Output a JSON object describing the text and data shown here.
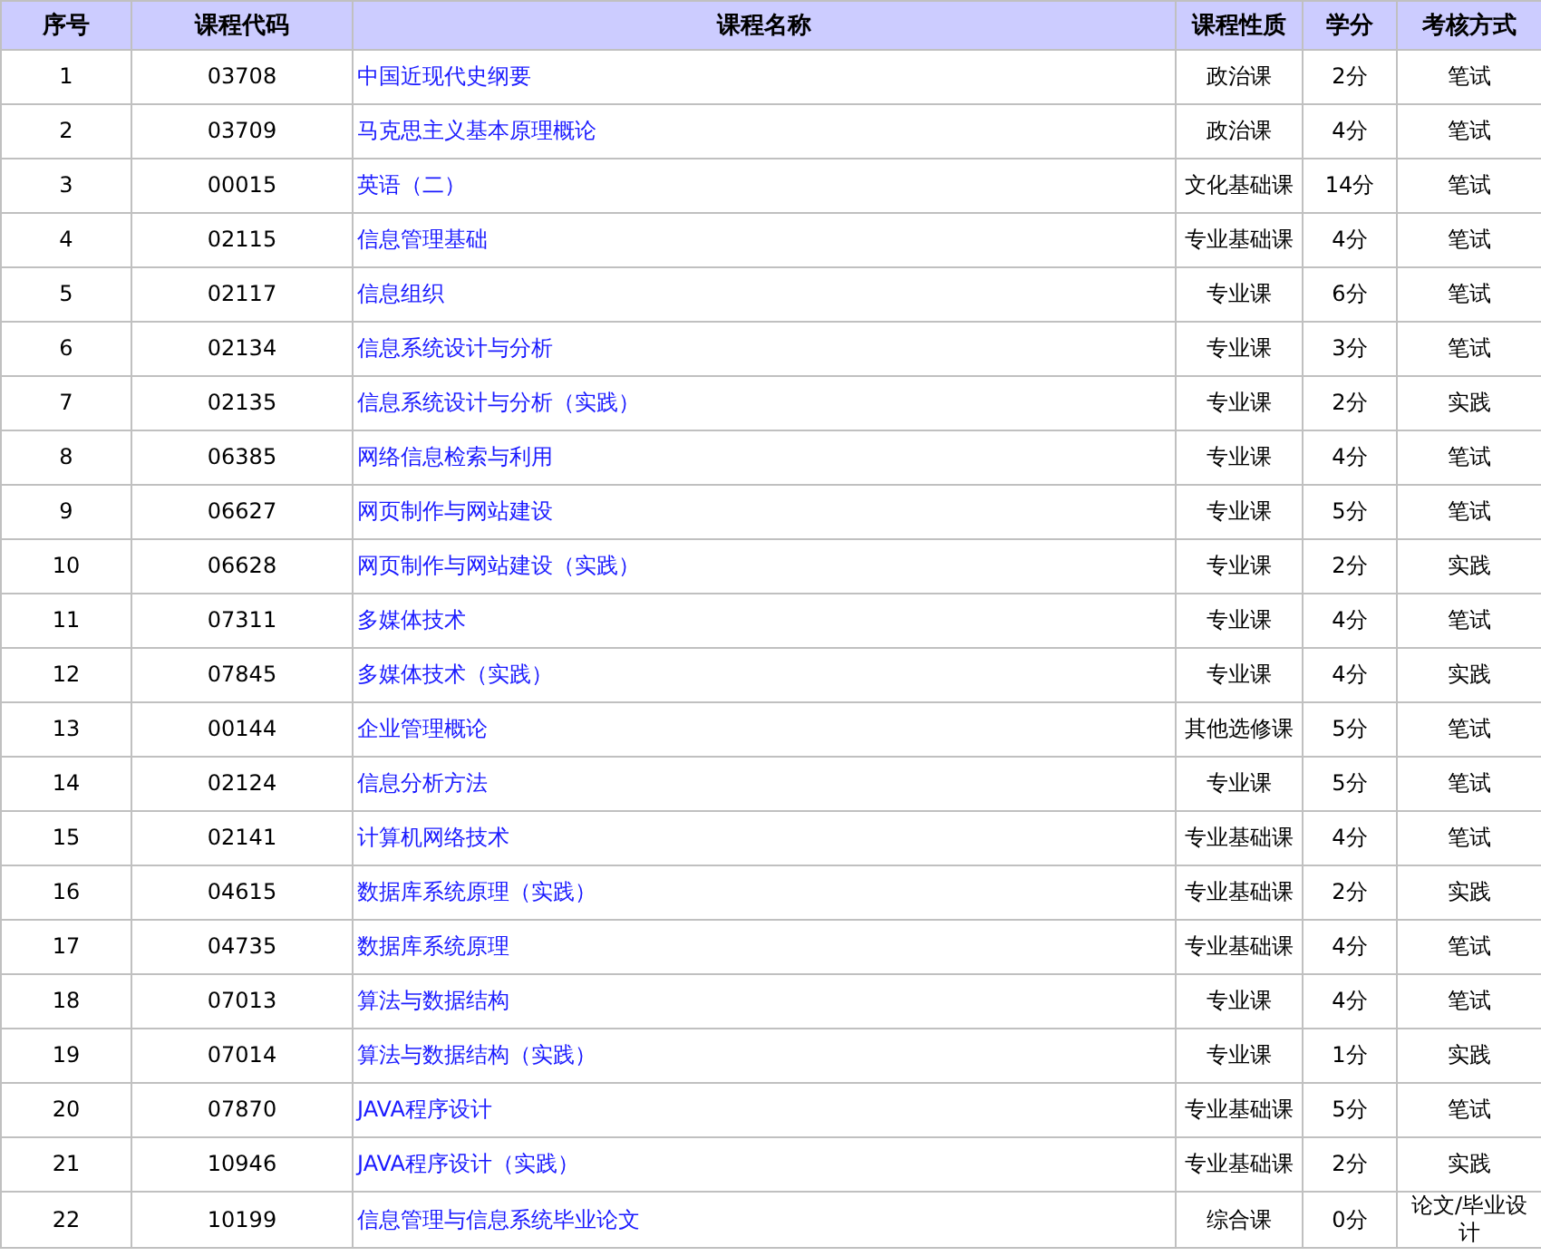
{
  "table": {
    "columns": [
      "序号",
      "课程代码",
      "课程名称",
      "课程性质",
      "学分",
      "考核方式"
    ],
    "rows": [
      [
        "1",
        "03708",
        "中国近现代史纲要",
        "政治课",
        "2分",
        "笔试"
      ],
      [
        "2",
        "03709",
        "马克思主义基本原理概论",
        "政治课",
        "4分",
        "笔试"
      ],
      [
        "3",
        "00015",
        "英语（二）",
        "文化基础课",
        "14分",
        "笔试"
      ],
      [
        "4",
        "02115",
        "信息管理基础",
        "专业基础课",
        "4分",
        "笔试"
      ],
      [
        "5",
        "02117",
        "信息组织",
        "专业课",
        "6分",
        "笔试"
      ],
      [
        "6",
        "02134",
        "信息系统设计与分析",
        "专业课",
        "3分",
        "笔试"
      ],
      [
        "7",
        "02135",
        "信息系统设计与分析（实践）",
        "专业课",
        "2分",
        "实践"
      ],
      [
        "8",
        "06385",
        "网络信息检索与利用",
        "专业课",
        "4分",
        "笔试"
      ],
      [
        "9",
        "06627",
        "网页制作与网站建设",
        "专业课",
        "5分",
        "笔试"
      ],
      [
        "10",
        "06628",
        "网页制作与网站建设（实践）",
        "专业课",
        "2分",
        "实践"
      ],
      [
        "11",
        "07311",
        "多媒体技术",
        "专业课",
        "4分",
        "笔试"
      ],
      [
        "12",
        "07845",
        "多媒体技术（实践）",
        "专业课",
        "4分",
        "实践"
      ],
      [
        "13",
        "00144",
        "企业管理概论",
        "其他选修课",
        "5分",
        "笔试"
      ],
      [
        "14",
        "02124",
        "信息分析方法",
        "专业课",
        "5分",
        "笔试"
      ],
      [
        "15",
        "02141",
        "计算机网络技术",
        "专业基础课",
        "4分",
        "笔试"
      ],
      [
        "16",
        "04615",
        "数据库系统原理（实践）",
        "专业基础课",
        "2分",
        "实践"
      ],
      [
        "17",
        "04735",
        "数据库系统原理",
        "专业基础课",
        "4分",
        "笔试"
      ],
      [
        "18",
        "07013",
        "算法与数据结构",
        "专业课",
        "4分",
        "笔试"
      ],
      [
        "19",
        "07014",
        "算法与数据结构（实践）",
        "专业课",
        "1分",
        "实践"
      ],
      [
        "20",
        "07870",
        "JAVA程序设计",
        "专业基础课",
        "5分",
        "笔试"
      ],
      [
        "21",
        "10946",
        "JAVA程序设计（实践）",
        "专业基础课",
        "2分",
        "实践"
      ],
      [
        "22",
        "10199",
        "信息管理与信息系统毕业论文",
        "综合课",
        "0分",
        "论文/毕业设计"
      ]
    ]
  }
}
